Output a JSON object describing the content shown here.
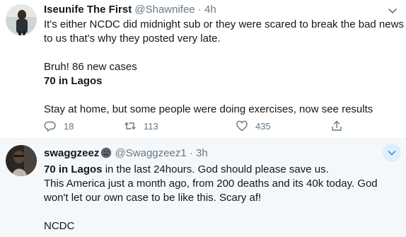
{
  "tweets": [
    {
      "name": "Iseunife The First",
      "handle": "@Shawnifee",
      "separator": "·",
      "time": "4h",
      "lines": [
        "It's either NCDC did midnight sub or they were scared to break the bad news",
        "to us that's why they posted very late.",
        "Bruh! 86 new cases",
        "70 in Lagos",
        "Stay at home, but some people were doing exercises, now see results"
      ],
      "actions": {
        "replies": "18",
        "retweets": "113",
        "likes": "435"
      }
    },
    {
      "name": "swaggzeez",
      "name_emoji": "slightly-frowning-face-emoji",
      "handle": "@Swaggzeez1",
      "separator": "·",
      "time": "3h",
      "line1_bold": "70 in Lagos",
      "line1_rest": " in the last 24hours. God should please save us.",
      "lines": [
        "This America just a month ago, from 200 deaths and its 40k today. God",
        "won't let our own case to be like this. Scary af!",
        "NCDC"
      ]
    }
  ],
  "icons": {
    "caret": "chevron-down-icon",
    "reply": "reply-icon",
    "retweet": "retweet-icon",
    "like": "heart-icon",
    "share": "share-icon"
  },
  "colors": {
    "text": "#14171a",
    "secondary": "#657786",
    "highlight_bg": "#f5f8fa",
    "accent": "#1da1f2"
  }
}
